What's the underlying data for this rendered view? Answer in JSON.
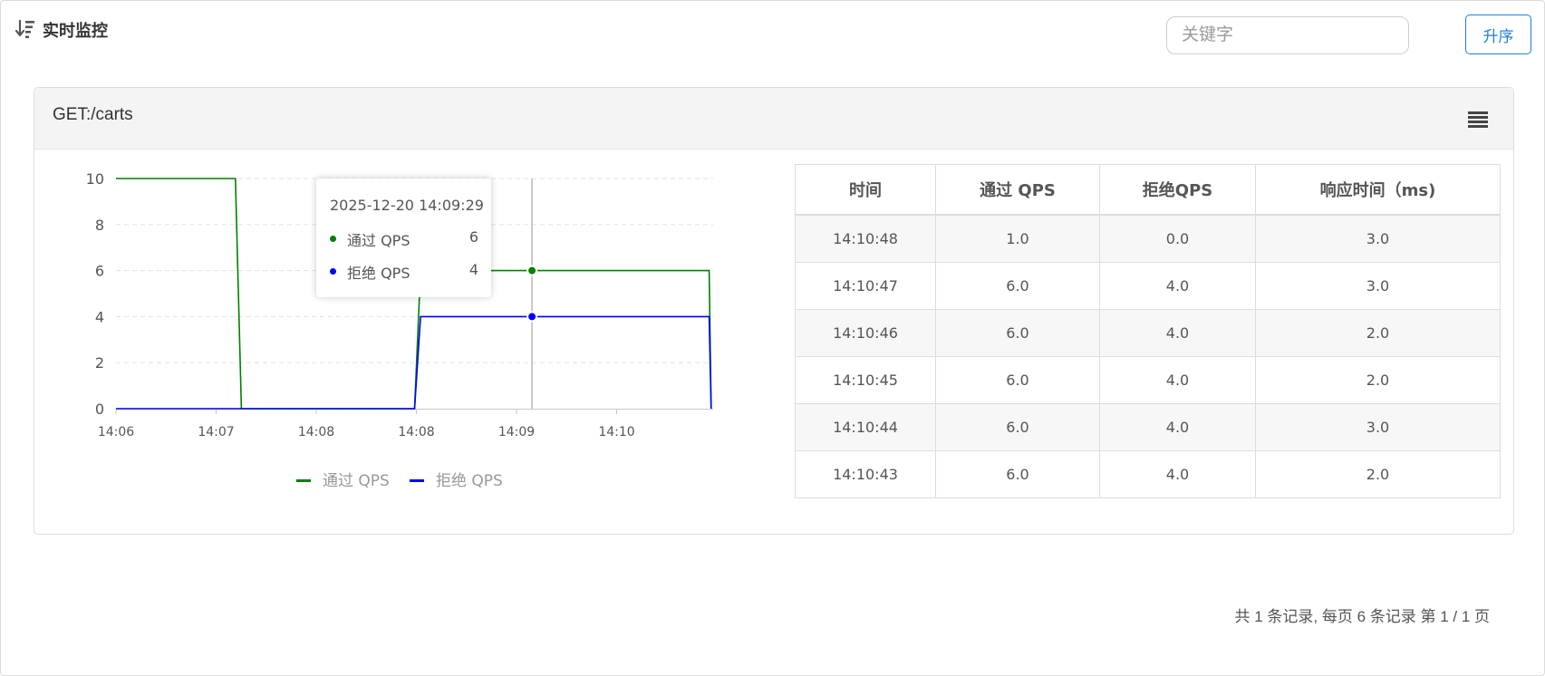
{
  "header": {
    "title": "实时监控",
    "icon": "sort-list-icon"
  },
  "search": {
    "placeholder": "关键字"
  },
  "sort_button": {
    "label": "升序",
    "color": "#1f7fd9"
  },
  "panel": {
    "title": "GET:/carts",
    "menu_icon": "hamburger-menu-icon"
  },
  "tooltip": {
    "time": "2025-12-20 14:09:29",
    "rows": [
      {
        "name": "通过 QPS",
        "value": "6",
        "color": "#008000"
      },
      {
        "name": "拒绝 QPS",
        "value": "4",
        "color": "#0000ff"
      }
    ]
  },
  "table": {
    "headers": [
      "时间",
      "通过 QPS",
      "拒绝QPS",
      "响应时间（ms)"
    ],
    "rows": [
      [
        "14:10:48",
        "1.0",
        "0.0",
        "3.0"
      ],
      [
        "14:10:47",
        "6.0",
        "4.0",
        "3.0"
      ],
      [
        "14:10:46",
        "6.0",
        "4.0",
        "2.0"
      ],
      [
        "14:10:45",
        "6.0",
        "4.0",
        "2.0"
      ],
      [
        "14:10:44",
        "6.0",
        "4.0",
        "3.0"
      ],
      [
        "14:10:43",
        "6.0",
        "4.0",
        "2.0"
      ]
    ]
  },
  "pager": {
    "text": "共 1 条记录, 每页 6 条记录 第 1 / 1 页"
  },
  "chart_data": {
    "type": "line",
    "x_ticks": [
      "14:06",
      "14:07",
      "14:08",
      "14:08",
      "14:09",
      "14:10"
    ],
    "y_ticks": [
      0,
      2,
      4,
      6,
      8,
      10
    ],
    "ylim": [
      0,
      10
    ],
    "grid": true,
    "legend_position": "bottom",
    "series": [
      {
        "name": "通过 QPS",
        "color": "#008000",
        "points": [
          [
            "14:06:00",
            10
          ],
          [
            "14:07:00",
            10
          ],
          [
            "14:07:03",
            0
          ],
          [
            "14:08:30",
            0
          ],
          [
            "14:08:33",
            6
          ],
          [
            "14:10:58",
            6
          ],
          [
            "14:10:59",
            0
          ]
        ]
      },
      {
        "name": "拒绝 QPS",
        "color": "#0000ff",
        "points": [
          [
            "14:06:00",
            0
          ],
          [
            "14:08:30",
            0
          ],
          [
            "14:08:33",
            4
          ],
          [
            "14:10:58",
            4
          ],
          [
            "14:10:59",
            0
          ]
        ]
      }
    ],
    "crosshair": {
      "x": "14:09:29",
      "values": [
        6,
        4
      ]
    }
  }
}
